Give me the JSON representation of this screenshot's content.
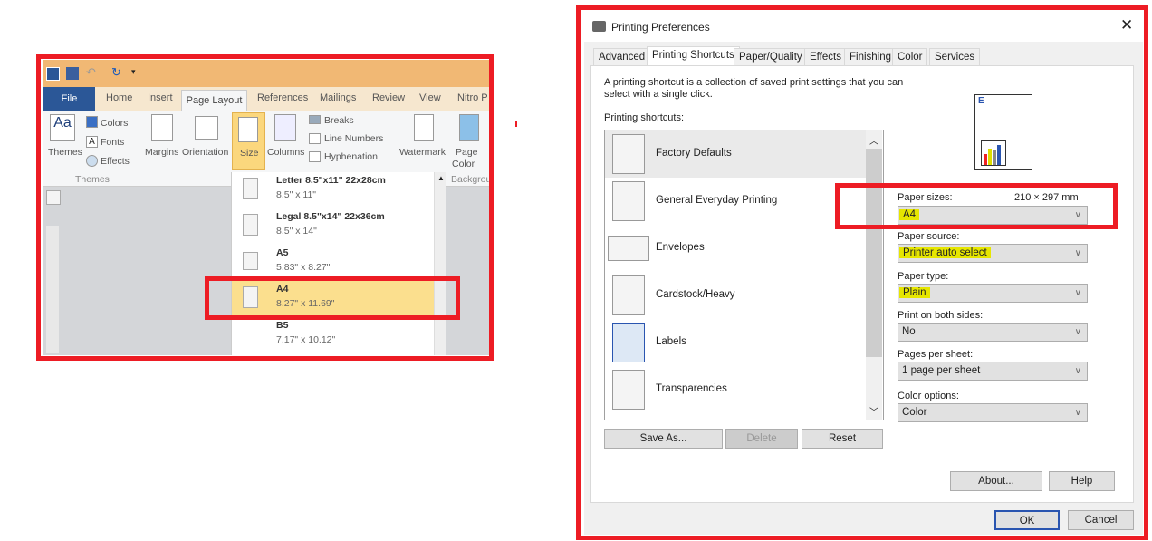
{
  "word": {
    "qat_icons": [
      "word-logo-icon",
      "save-icon",
      "undo-icon",
      "redo-icon",
      "customize-icon"
    ],
    "tabs": {
      "file": "File",
      "home": "Home",
      "insert": "Insert",
      "page_layout": "Page Layout",
      "references": "References",
      "mailings": "Mailings",
      "review": "Review",
      "view": "View",
      "nitro": "Nitro P"
    },
    "ribbon": {
      "themes": "Themes",
      "colors": "Colors",
      "fonts": "Fonts",
      "effects": "Effects",
      "group_themes": "Themes",
      "margins": "Margins",
      "orientation": "Orientation",
      "size": "Size",
      "columns": "Columns",
      "breaks": "Breaks",
      "line_numbers": "Line Numbers",
      "hyphenation": "Hyphenation",
      "watermark": "Watermark",
      "page_color_1": "Page",
      "page_color_2": "Color",
      "group_background": "Backgrou"
    },
    "size_menu": [
      {
        "title": "Letter 8.5\"x11\" 22x28cm",
        "size": "8.5\" x 11\""
      },
      {
        "title": "Legal 8.5\"x14\" 22x36cm",
        "size": "8.5\" x 14\""
      },
      {
        "title": "A5",
        "size": "5.83\" x 8.27\""
      },
      {
        "title": "A4",
        "size": "8.27\" x 11.69\"",
        "selected": true
      },
      {
        "title": "B5",
        "size": "7.17\" x 10.12\""
      }
    ]
  },
  "dialog": {
    "title": "Printing Preferences",
    "tabs": [
      "Advanced",
      "Printing Shortcuts",
      "Paper/Quality",
      "Effects",
      "Finishing",
      "Color",
      "Services"
    ],
    "active_tab": "Printing Shortcuts",
    "description": "A printing shortcut is a collection of saved print settings that you can select with a single click.",
    "shortcuts_label": "Printing shortcuts:",
    "shortcuts": [
      "Factory Defaults",
      "General Everyday Printing",
      "Envelopes",
      "Cardstock/Heavy",
      "Labels",
      "Transparencies"
    ],
    "buttons": {
      "save_as": "Save As...",
      "delete": "Delete",
      "reset": "Reset",
      "about": "About...",
      "help": "Help",
      "ok": "OK",
      "cancel": "Cancel"
    },
    "fields": {
      "paper_sizes": {
        "label": "Paper sizes:",
        "dims": "210 × 297 mm",
        "value": "A4"
      },
      "paper_source": {
        "label": "Paper source:",
        "value": "Printer auto select"
      },
      "paper_type": {
        "label": "Paper type:",
        "value": "Plain"
      },
      "both_sides": {
        "label": "Print on both sides:",
        "value": "No"
      },
      "pages_per_sheet": {
        "label": "Pages per sheet:",
        "value": "1 page per sheet"
      },
      "color_options": {
        "label": "Color options:",
        "value": "Color"
      }
    }
  },
  "colors": {
    "annotation_red": "#ed1c24",
    "highlight_yellow": "#e6e600",
    "word_selected": "#fbd77d"
  }
}
